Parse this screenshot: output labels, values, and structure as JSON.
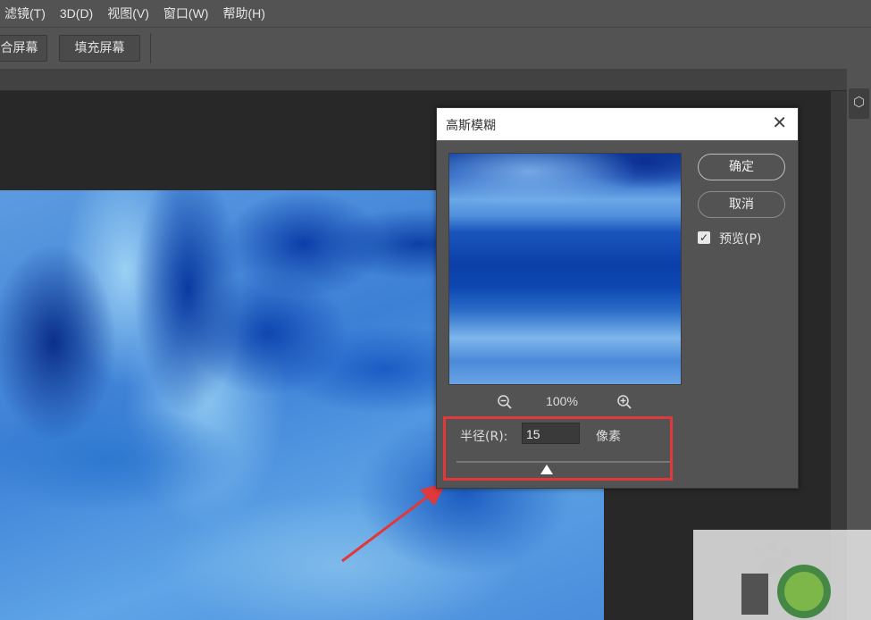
{
  "menubar": {
    "items": [
      "滤镜(T)",
      "3D(D)",
      "视图(V)",
      "窗口(W)",
      "帮助(H)"
    ]
  },
  "options_bar": {
    "buttons": [
      "合屏幕",
      "填充屏幕"
    ]
  },
  "dialog": {
    "title": "高斯模糊",
    "ok_label": "确定",
    "cancel_label": "取消",
    "preview_label": "预览(P)",
    "preview_checked": true,
    "zoom_level": "100%",
    "radius_label": "半径(R):",
    "radius_value": "15",
    "radius_unit": "像素"
  },
  "colors": {
    "highlight": "#e0393b",
    "ui_panel": "#535353",
    "canvas_bg": "#282828"
  },
  "icons": {
    "zoom_out": "zoom-out-icon",
    "zoom_in": "zoom-in-icon",
    "close": "close-icon",
    "check": "checkbox-check-icon",
    "panel": "3d-cube-icon"
  }
}
